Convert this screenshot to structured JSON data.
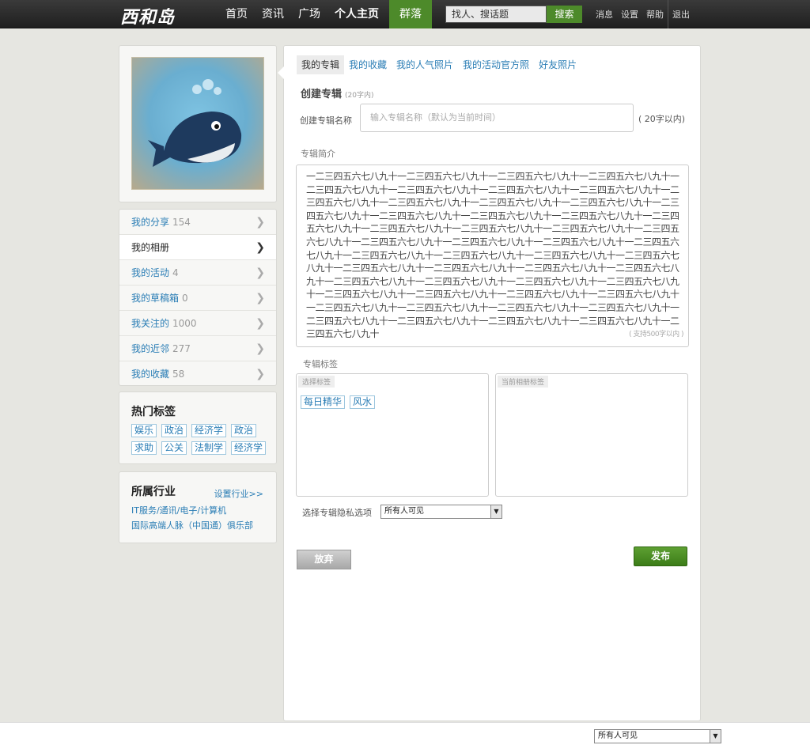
{
  "brand": {
    "logo_text": "西和岛"
  },
  "nav": {
    "items": [
      {
        "label": "首页"
      },
      {
        "label": "资讯"
      },
      {
        "label": "广场"
      },
      {
        "label": "个人主页"
      },
      {
        "label": "群落"
      }
    ],
    "search_placeholder": "找人、搜话题",
    "search_button": "搜索",
    "user_links": [
      "消息",
      "设置",
      "帮助",
      "退出"
    ]
  },
  "sidebar": {
    "menu": [
      {
        "label": "我的分享",
        "count": "154"
      },
      {
        "label": "我的相册",
        "count": ""
      },
      {
        "label": "我的活动",
        "count": "4"
      },
      {
        "label": "我的草稿箱",
        "count": "0"
      },
      {
        "label": "我关注的",
        "count": "1000"
      },
      {
        "label": "我的近邻",
        "count": "277"
      },
      {
        "label": "我的收藏",
        "count": "58"
      }
    ],
    "hot_tags_title": "热门标签",
    "hot_tags_row1": [
      "娱乐",
      "政治",
      "经济学",
      "政治"
    ],
    "hot_tags_row2": [
      "求助",
      "公关",
      "法制学",
      "经济学"
    ],
    "industry_title": "所属行业",
    "industry_set": "设置行业>>",
    "industries": [
      "IT服务/通讯/电子/计算机",
      "国际高端人脉（中国通）俱乐部"
    ]
  },
  "main": {
    "tabs": [
      "我的专辑",
      "我的收藏",
      "我的人气照片",
      "我的活动官方照",
      "好友照片"
    ],
    "section_title": "创建专辑",
    "section_hint": "(20字内)",
    "name_label": "创建专辑名称",
    "name_placeholder": "输入专辑名称（默认为当前时间）",
    "name_limit": "( 20字以内)",
    "desc_label": "专辑简介",
    "desc_text": "一二三四五六七八九十一二三四五六七八九十一二三四五六七八九十一二三四五六七八九十一二三四五六七八九十一二三四五六七八九十一二三四五六七八九十一二三四五六七八九十一二三四五六七八九十一二三四五六七八九十一二三四五六七八九十一二三四五六七八九十一二三四五六七八九十一二三四五六七八九十一二三四五六七八九十一二三四五六七八九十一二三四五六七八九十一二三四五六七八九十一二三四五六七八九十一二三四五六七八九十一二三四五六七八九十一二三四五六七八九十一二三四五六七八九十一二三四五六七八九十一二三四五六七八九十一二三四五六七八九十一二三四五六七八九十一二三四五六七八九十一二三四五六七八九十一二三四五六七八九十一二三四五六七八九十一二三四五六七八九十一二三四五六七八九十一二三四五六七八九十一二三四五六七八九十一二三四五六七八九十一二三四五六七八九十一二三四五六七八九十一二三四五六七八九十一二三四五六七八九十一二三四五六七八九十一二三四五六七八九十一二三四五六七八九十一二三四五六七八九十一二三四五六七八九十一二三四五六七八九十一二三四五六七八九十一二三四五六七八九十一二三四五六七八九十一二三四五六七八九十",
    "desc_limit": "( 支持500字以内 )",
    "tags_label": "专辑标签",
    "select_tags_header": "选择标签",
    "current_tags_header": "当前相册标签",
    "selectable_tags": [
      "每日精华",
      "风水"
    ],
    "privacy_label": "选择专辑隐私选项",
    "privacy_value": "所有人可见",
    "cancel_button": "放弃",
    "publish_button": "发布"
  },
  "footer": {
    "select_value": "所有人可见"
  },
  "colors": {
    "accent_green": "#4d8a2a",
    "link_blue": "#2a7db5",
    "topbar": "#2b2b2b"
  },
  "icons": {
    "whale_avatar": "whale-icon",
    "chevron": "chevron-right-icon",
    "dropdown": "dropdown-arrow-icon"
  }
}
